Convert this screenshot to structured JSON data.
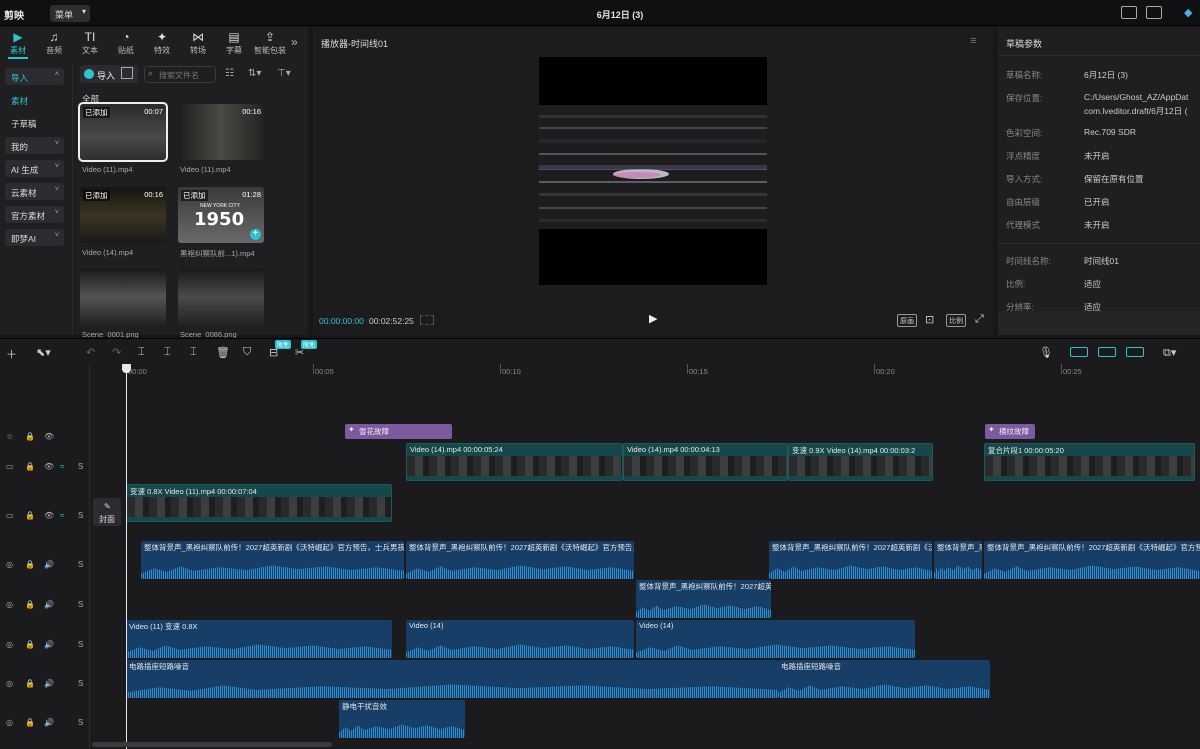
{
  "app": {
    "logo": "剪映",
    "menu": "菜单",
    "doc_title": "6月12日 (3)"
  },
  "toolbar": {
    "tools": [
      {
        "icon": "media-icon",
        "glyph": "▶",
        "label": "素材"
      },
      {
        "icon": "audio-icon",
        "glyph": "♫",
        "label": "音频"
      },
      {
        "icon": "text-icon",
        "glyph": "TI",
        "label": "文本"
      },
      {
        "icon": "sticker-icon",
        "glyph": "◔",
        "label": "贴纸"
      },
      {
        "icon": "effects-icon",
        "glyph": "✦",
        "label": "特效"
      },
      {
        "icon": "transition-icon",
        "glyph": "⋈",
        "label": "转场"
      },
      {
        "icon": "subtitle-icon",
        "glyph": "▤",
        "label": "字幕"
      },
      {
        "icon": "package-icon",
        "glyph": "⇪",
        "label": "智能包装"
      }
    ],
    "more": "»"
  },
  "categories": [
    {
      "label": "导入",
      "boxed": true,
      "selected": true
    },
    {
      "label": "素材",
      "boxed": false
    },
    {
      "label": "子草稿",
      "boxed": false
    },
    {
      "label": "我的",
      "boxed": true
    },
    {
      "label": "AI 生成",
      "boxed": true
    },
    {
      "label": "云素材",
      "boxed": true
    },
    {
      "label": "官方素材",
      "boxed": true
    },
    {
      "label": "即梦AI",
      "boxed": true
    }
  ],
  "media": {
    "import_label": "导入",
    "search_placeholder": "搜索文件名",
    "section": "全部",
    "items": [
      {
        "name": "Video (11).mp4",
        "tag": "已添加",
        "duration": "00:07"
      },
      {
        "name": "Video (11).mp4",
        "tag": "",
        "duration": "00:16"
      },
      {
        "name": "Video (14).mp4",
        "tag": "已添加",
        "duration": "00:16"
      },
      {
        "name": "黑袍纠察队前...1).mp4",
        "tag": "已添加",
        "duration": "01:28",
        "overlay": "1950"
      },
      {
        "name": "Scene_0001.png",
        "tag": "",
        "duration": ""
      },
      {
        "name": "Scene_0086.png",
        "tag": "",
        "duration": ""
      }
    ],
    "overlay_small": "NEW YORK CITY"
  },
  "player": {
    "title": "播放器-时间线01",
    "current": "00:00:00:00",
    "total": "00:02:52:25",
    "btn_original": "原画",
    "btn_ratio": "比例"
  },
  "props": {
    "title": "草稿参数",
    "rows": [
      {
        "k": "草稿名称:",
        "v": "6月12日 (3)"
      },
      {
        "k": "保存位置:",
        "v": "C:/Users/Ghost_AZ/AppDat"
      },
      {
        "k": "",
        "v": "com.lveditor.draft/6月12日 ("
      },
      {
        "k": "色彩空间:",
        "v": "Rec.709 SDR"
      },
      {
        "k": "浮点精度",
        "v": "未开启"
      },
      {
        "k": "导入方式:",
        "v": "保留在原有位置"
      },
      {
        "k": "自由层级",
        "v": "已开启"
      },
      {
        "k": "代理模式",
        "v": "未开启"
      },
      {
        "k": "时间线名称:",
        "v": "时间线01"
      },
      {
        "k": "比例:",
        "v": "适应"
      },
      {
        "k": "分辨率:",
        "v": "适应"
      }
    ]
  },
  "timeline": {
    "badge": "限免",
    "ticks": [
      "00:00",
      "00:05",
      "00:10",
      "00:15",
      "00:20",
      "00:25"
    ],
    "cover_label": "封面",
    "fx": [
      {
        "label": "雪花故障"
      },
      {
        "label": "横纹故障"
      }
    ],
    "video_main": [
      {
        "label": "Video (14).mp4  00:00:05:24"
      },
      {
        "label": "Video (14).mp4  00:00:04:13"
      },
      {
        "label": "变速 0.9X   Video (14).mp4  00:00:03:2"
      },
      {
        "label": "复合片段1  00:00:05:20"
      }
    ],
    "video_base": {
      "label": "变速 0.8X   Video (11).mp4  00:00:07:04"
    },
    "audio_bg": [
      {
        "label": "整体背景声_黑袍纠察队前传！2027超英新剧《沃特崛起》官方预告，士兵男孩，"
      },
      {
        "label": "整体背景声_黑袍纠察队前传！2027超英新剧《沃特崛起》官方预告，士"
      },
      {
        "label": "整体背景声_黑袍纠察队前传！2027超英新剧《沃特"
      },
      {
        "label": "整体背景声_黑"
      },
      {
        "label": "整体背景声_黑袍纠察队前传！2027超英新剧《沃特崛起》官方预"
      }
    ],
    "audio_bg2": {
      "label": "整体背景声_黑袍纠察队前传！2027超英新"
    },
    "audio_src": [
      {
        "label": "Video (11)   变速 0.8X"
      },
      {
        "label": "Video (14)"
      },
      {
        "label": "Video (14)"
      }
    ],
    "audio_noise": [
      {
        "label": "电路插座短路噪音"
      },
      {
        "label": "电路插座短路噪音"
      }
    ],
    "audio_static": {
      "label": "静电干扰音效"
    }
  },
  "colors": {
    "accent": "#2fc3cf",
    "video_clip": "#16474a",
    "audio_clip": "#163e66",
    "effect_clip": "#7c5aa0"
  }
}
